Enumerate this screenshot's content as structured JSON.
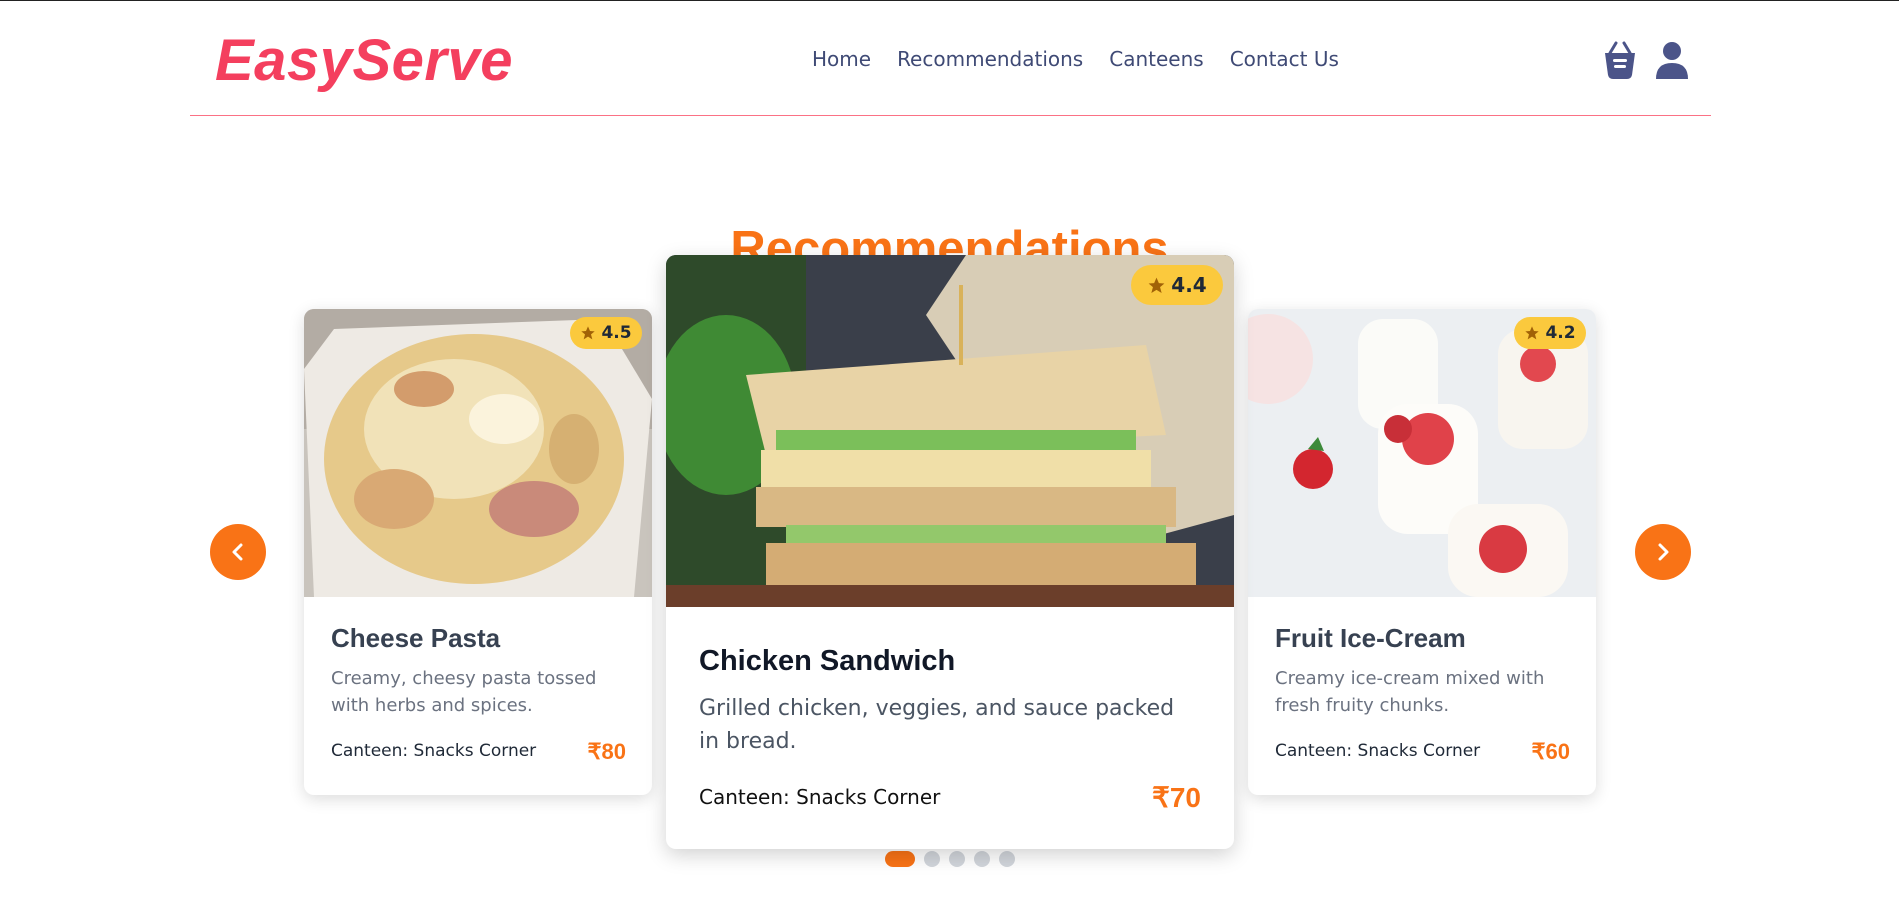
{
  "header": {
    "logo": "EasyServe",
    "nav": [
      "Home",
      "Recommendations",
      "Canteens",
      "Contact Us"
    ],
    "icons": [
      "basket-icon",
      "user-icon"
    ]
  },
  "section": {
    "title": "Recommendations"
  },
  "cards": [
    {
      "name": "Cheese Pasta",
      "rating": "4.5",
      "description": "Creamy, cheesy pasta tossed with herbs and spices.",
      "canteen": "Canteen: Snacks Corner",
      "price": "₹80"
    },
    {
      "name": "Chicken Sandwich",
      "rating": "4.4",
      "description": "Grilled chicken, veggies, and sauce packed in bread.",
      "canteen": "Canteen: Snacks Corner",
      "price": "₹70"
    },
    {
      "name": "Fruit Ice-Cream",
      "rating": "4.2",
      "description": "Creamy ice-cream mixed with fresh fruity chunks.",
      "canteen": "Canteen: Snacks Corner",
      "price": "₹60"
    }
  ],
  "carousel": {
    "active_index": 0,
    "dot_count": 5
  },
  "colors": {
    "brand": "#f43f5e",
    "accent": "#f97316",
    "nav": "#3f4a75",
    "rating_badge": "#fbc93d"
  }
}
